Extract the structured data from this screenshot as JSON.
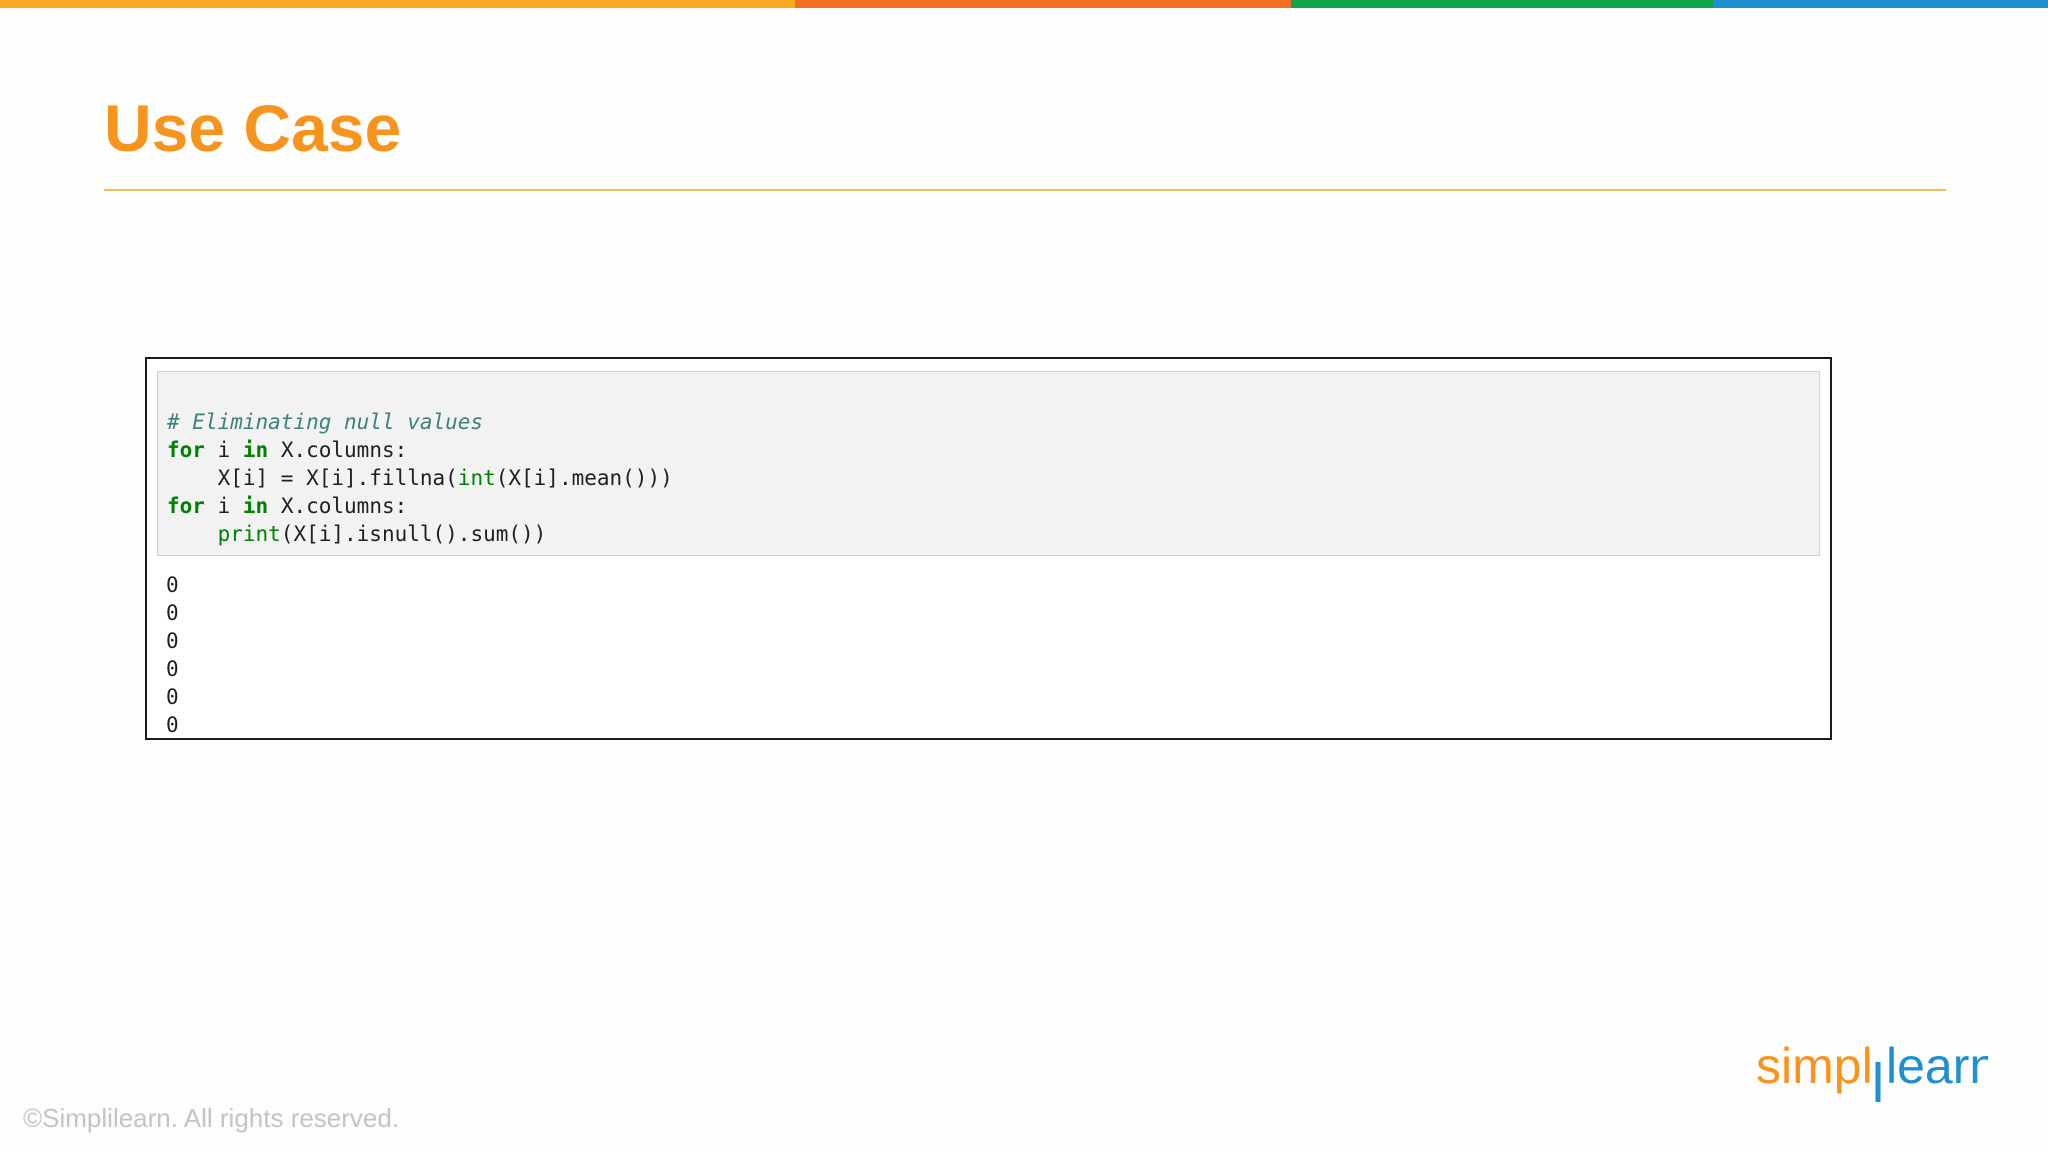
{
  "colors": {
    "top_bar": [
      "#f9a825",
      "#f26f21",
      "#13a14a",
      "#1e8fd0"
    ],
    "title": "#f7941d",
    "rule": "#e8c25a",
    "comment": "#3d7f7f",
    "keyword": "#008000",
    "logo_orange": "#f7941d",
    "logo_blue": "#1e8fd0"
  },
  "slide": {
    "title": "Use Case",
    "copyright": "©Simplilearn. All rights reserved.",
    "logo_text": "simplilearn"
  },
  "notebook": {
    "code": {
      "comment": "# Eliminating null values",
      "line2_kw1": "for",
      "line2_var": " i ",
      "line2_kw2": "in",
      "line2_rest": " X.columns:",
      "line3_indent": "    X[i] = X[i].fillna(",
      "line3_builtin": "int",
      "line3_rest": "(X[i].mean()))",
      "line4_kw1": "for",
      "line4_var": " i ",
      "line4_kw2": "in",
      "line4_rest": " X.columns:",
      "line5_indent": "    ",
      "line5_builtin": "print",
      "line5_rest": "(X[i].isnull().sum())"
    },
    "output": [
      "0",
      "0",
      "0",
      "0",
      "0",
      "0"
    ]
  }
}
